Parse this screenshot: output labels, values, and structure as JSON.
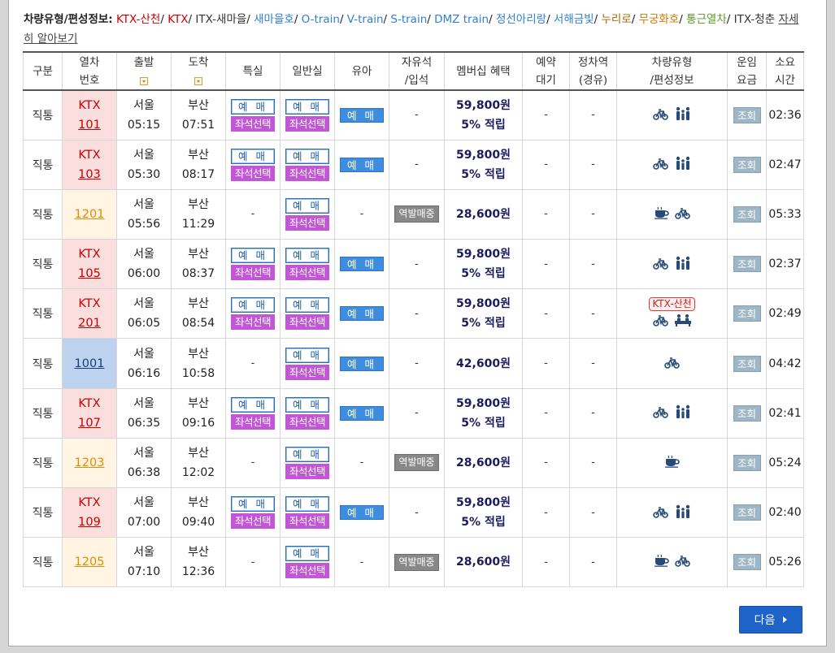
{
  "legend": {
    "lead": "차량유형/편성정보:",
    "items": [
      {
        "label": "KTX-산천",
        "color": "#cc0000"
      },
      {
        "label": "KTX",
        "color": "#cc0000"
      },
      {
        "label": "ITX-새마을",
        "color": "#333333"
      },
      {
        "label": "새마을호",
        "color": "#2f7fd1"
      },
      {
        "label": "O-train",
        "color": "#2f7fd1"
      },
      {
        "label": "V-train",
        "color": "#2f7fd1"
      },
      {
        "label": "S-train",
        "color": "#2f7fd1"
      },
      {
        "label": "DMZ train",
        "color": "#2f7fd1"
      },
      {
        "label": "정선아리랑",
        "color": "#2f7fd1"
      },
      {
        "label": "서해금빛",
        "color": "#2f7fd1"
      },
      {
        "label": "누리로",
        "color": "#a06a00"
      },
      {
        "label": "무궁화호",
        "color": "#d07a00"
      },
      {
        "label": "통근열차",
        "color": "#5a9a1e"
      },
      {
        "label": "ITX-청춘",
        "color": "#333333"
      }
    ],
    "more_link": "자세히 알아보기"
  },
  "headers": {
    "gubun": "구분",
    "train_no_1": "열차",
    "train_no_2": "번호",
    "dep": "출발",
    "arr": "도착",
    "special": "특실",
    "general": "일반실",
    "baby": "유아",
    "free_1": "자유석",
    "free_2": "/입석",
    "membership": "멤버십 혜택",
    "wait_1": "예약",
    "wait_2": "대기",
    "via_1": "정차역",
    "via_2": "(경유)",
    "vehicle_1": "차량유형",
    "vehicle_2": "/편성정보",
    "fare_1": "운임",
    "fare_2": "요금",
    "dur_1": "소요",
    "dur_2": "시간"
  },
  "buttons": {
    "buy": "예 매",
    "seat": "좌석선택",
    "baby": "예 매",
    "station_sale": "역발매중",
    "fare": "조회",
    "dash": "-",
    "next": "다음"
  },
  "rows": [
    {
      "gubun": "직통",
      "type": "ktx",
      "prefix": "KTX",
      "no": "101",
      "dep_st": "서울",
      "dep_t": "05:15",
      "arr_st": "부산",
      "arr_t": "07:51",
      "special": true,
      "baby": true,
      "station_sale": false,
      "price": "59,800원",
      "point": "5% 적립",
      "icons": [
        "bike",
        "family"
      ],
      "badge": "",
      "dur": "02:36"
    },
    {
      "gubun": "직통",
      "type": "ktx",
      "prefix": "KTX",
      "no": "103",
      "dep_st": "서울",
      "dep_t": "05:30",
      "arr_st": "부산",
      "arr_t": "08:17",
      "special": true,
      "baby": true,
      "station_sale": false,
      "price": "59,800원",
      "point": "5% 적립",
      "icons": [
        "bike",
        "family"
      ],
      "badge": "",
      "dur": "02:47"
    },
    {
      "gubun": "직통",
      "type": "mugung",
      "prefix": "",
      "no": "1201",
      "dep_st": "서울",
      "dep_t": "05:56",
      "arr_st": "부산",
      "arr_t": "11:29",
      "special": false,
      "baby": false,
      "station_sale": true,
      "price": "28,600원",
      "point": "",
      "icons": [
        "cafe",
        "bike"
      ],
      "badge": "",
      "dur": "05:33"
    },
    {
      "gubun": "직통",
      "type": "ktx",
      "prefix": "KTX",
      "no": "105",
      "dep_st": "서울",
      "dep_t": "06:00",
      "arr_st": "부산",
      "arr_t": "08:37",
      "special": true,
      "baby": true,
      "station_sale": false,
      "price": "59,800원",
      "point": "5% 적립",
      "icons": [
        "bike",
        "family"
      ],
      "badge": "",
      "dur": "02:37"
    },
    {
      "gubun": "직통",
      "type": "ktx",
      "prefix": "KTX",
      "no": "201",
      "dep_st": "서울",
      "dep_t": "06:05",
      "arr_st": "부산",
      "arr_t": "08:54",
      "special": true,
      "baby": true,
      "station_sale": false,
      "price": "59,800원",
      "point": "5% 적립",
      "icons": [
        "bike",
        "lounge"
      ],
      "badge": "KTX-산천",
      "dur": "02:49"
    },
    {
      "gubun": "직통",
      "type": "nuri",
      "prefix": "",
      "no": "1001",
      "dep_st": "서울",
      "dep_t": "06:16",
      "arr_st": "부산",
      "arr_t": "10:58",
      "special": false,
      "baby": true,
      "station_sale": false,
      "price": "42,600원",
      "point": "",
      "icons": [
        "bike"
      ],
      "badge": "",
      "dur": "04:42"
    },
    {
      "gubun": "직통",
      "type": "ktx",
      "prefix": "KTX",
      "no": "107",
      "dep_st": "서울",
      "dep_t": "06:35",
      "arr_st": "부산",
      "arr_t": "09:16",
      "special": true,
      "baby": true,
      "station_sale": false,
      "price": "59,800원",
      "point": "5% 적립",
      "icons": [
        "bike",
        "family"
      ],
      "badge": "",
      "dur": "02:41"
    },
    {
      "gubun": "직통",
      "type": "mugung",
      "prefix": "",
      "no": "1203",
      "dep_st": "서울",
      "dep_t": "06:38",
      "arr_st": "부산",
      "arr_t": "12:02",
      "special": false,
      "baby": false,
      "station_sale": true,
      "price": "28,600원",
      "point": "",
      "icons": [
        "cafe"
      ],
      "badge": "",
      "dur": "05:24"
    },
    {
      "gubun": "직통",
      "type": "ktx",
      "prefix": "KTX",
      "no": "109",
      "dep_st": "서울",
      "dep_t": "07:00",
      "arr_st": "부산",
      "arr_t": "09:40",
      "special": true,
      "baby": true,
      "station_sale": false,
      "price": "59,800원",
      "point": "5% 적립",
      "icons": [
        "bike",
        "family"
      ],
      "badge": "",
      "dur": "02:40"
    },
    {
      "gubun": "직통",
      "type": "mugung",
      "prefix": "",
      "no": "1205",
      "dep_st": "서울",
      "dep_t": "07:10",
      "arr_st": "부산",
      "arr_t": "12:36",
      "special": false,
      "baby": false,
      "station_sale": true,
      "price": "28,600원",
      "point": "",
      "icons": [
        "cafe",
        "bike"
      ],
      "badge": "",
      "dur": "05:26"
    }
  ]
}
